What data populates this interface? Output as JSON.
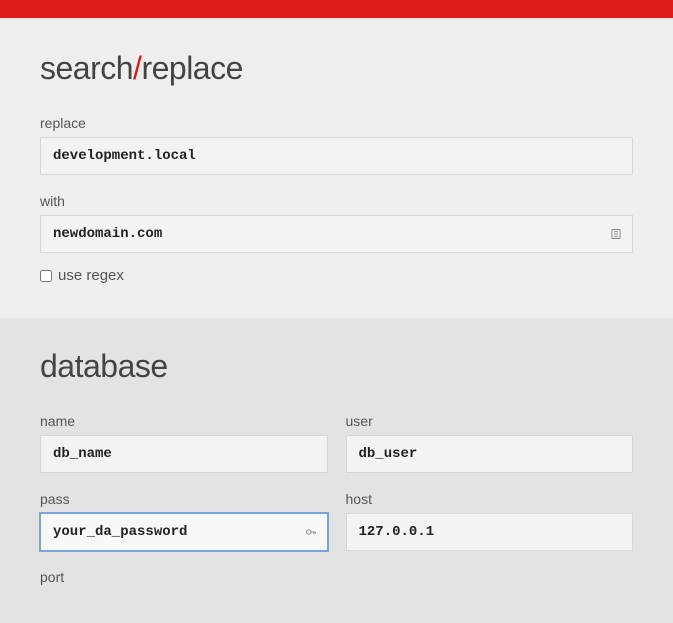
{
  "header": {
    "title_part1": "search",
    "title_slash": "/",
    "title_part2": "replace"
  },
  "search_replace": {
    "replace_label": "replace",
    "replace_value": "development.local",
    "with_label": "with",
    "with_value": "newdomain.com",
    "regex_checkbox_label": "use regex",
    "regex_checked": false
  },
  "database": {
    "heading": "database",
    "name_label": "name",
    "name_value": "db_name",
    "user_label": "user",
    "user_value": "db_user",
    "pass_label": "pass",
    "pass_value": "your_da_password",
    "host_label": "host",
    "host_value": "127.0.0.1",
    "port_label": "port"
  }
}
